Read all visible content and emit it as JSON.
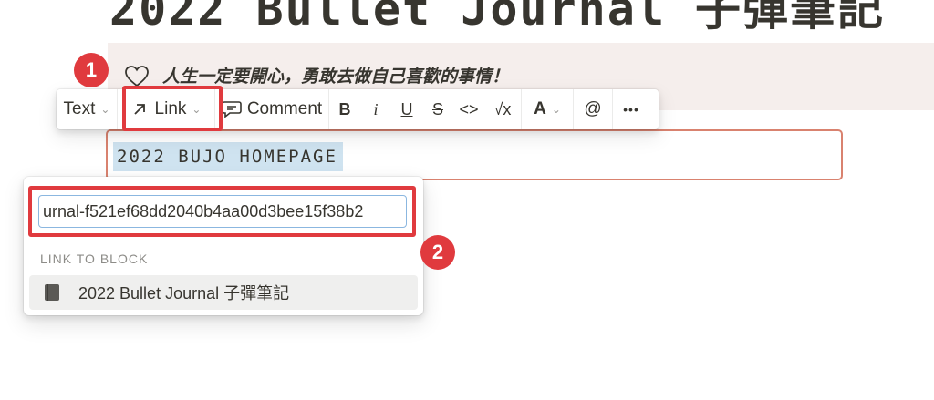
{
  "page": {
    "title": "2022 Bullet Journal 子彈筆記"
  },
  "callout": {
    "icon": "heart-outline-icon",
    "text": "人生一定要開心，勇敢去做自己喜歡的事情！"
  },
  "toolbar": {
    "text_label": "Text",
    "link_label": "Link",
    "comment_label": "Comment",
    "bold": "B",
    "italic": "i",
    "underline": "U",
    "strike": "S",
    "code": "<>",
    "equation": "√x",
    "color": "A",
    "mention": "@",
    "more": "•••"
  },
  "block": {
    "selected_text": "2022 BUJO HOMEPAGE"
  },
  "link_popup": {
    "input_value": "urnal-f521ef68dd2040b4aa00d3bee15f38b2",
    "section_label": "LINK TO BLOCK",
    "result": {
      "icon": "page-book-icon",
      "label": "2022 Bullet Journal 子彈筆記"
    }
  },
  "annotations": {
    "step1": "1",
    "step2": "2",
    "color": "#e03a3e"
  }
}
